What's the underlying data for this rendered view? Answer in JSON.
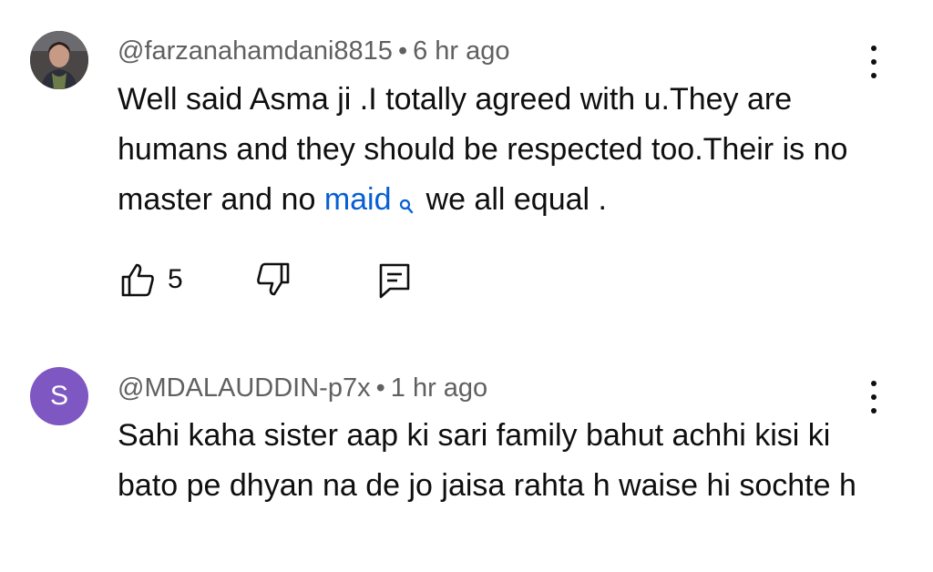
{
  "comments": [
    {
      "author": "@farzanahamdani8815",
      "separator": "•",
      "time": "6 hr ago",
      "text_before_link": "Well said Asma ji .I totally agreed with u.They are humans and they should be respected too.Their is no master and no",
      "link_text": "maid",
      "text_after_link": "we all equal .",
      "like_count": "5",
      "avatar": "profile-photo"
    },
    {
      "author": "@MDALAUDDIN-p7x",
      "separator": "•",
      "time": "1 hr ago",
      "text": "Sahi kaha sister aap ki sari family bahut achhi kisi ki bato pe dhyan na de jo jaisa rahta h waise hi sochte h",
      "avatar_letter": "S",
      "avatar_color": "#7e57c2"
    }
  ],
  "icons": {
    "like": "thumbs-up-icon",
    "dislike": "thumbs-down-icon",
    "reply": "comment-reply-icon",
    "more": "more-vertical-icon",
    "link_search": "search-icon"
  },
  "colors": {
    "link": "#065fd4",
    "meta": "#606060",
    "text": "#0f0f0f"
  }
}
